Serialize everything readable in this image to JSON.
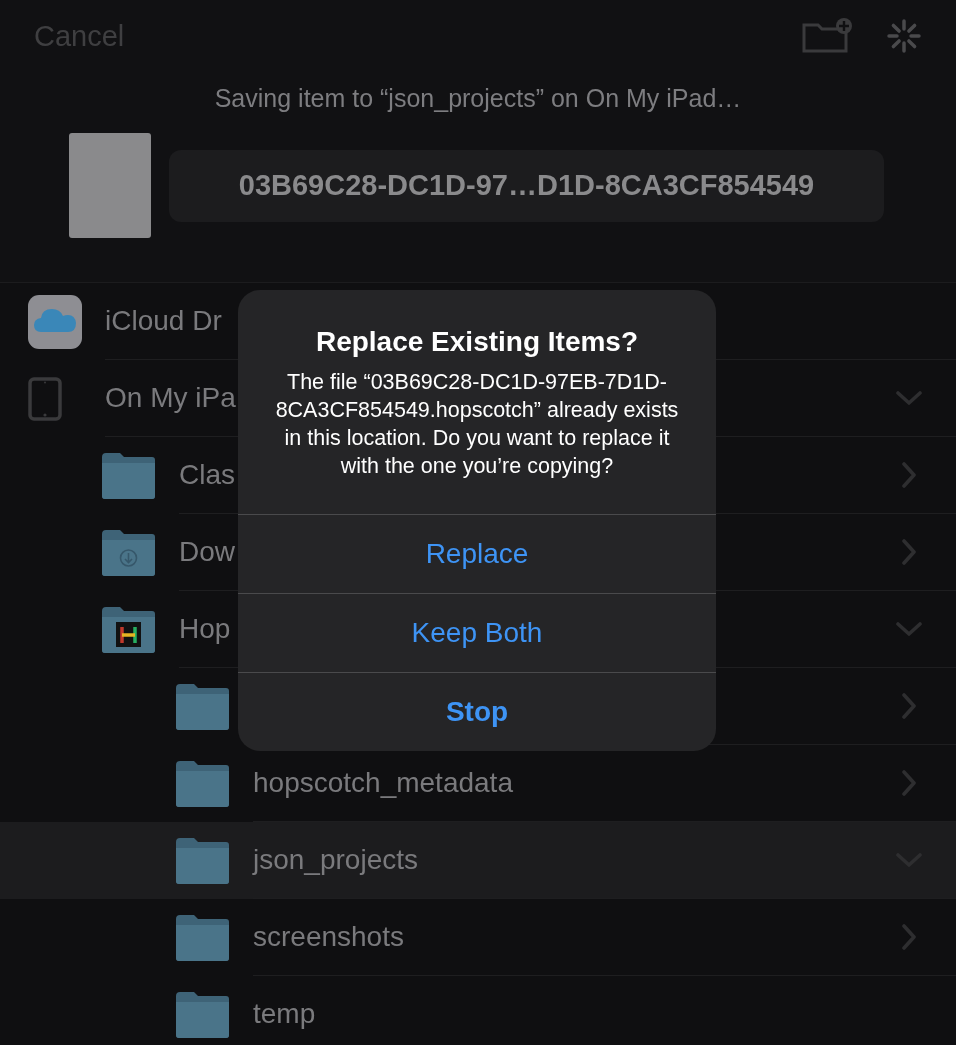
{
  "header": {
    "cancel": "Cancel",
    "status": "Saving item to “json_projects” on On My iPad…",
    "filename": "03B69C28-DC1D-97…D1D-8CA3CF854549"
  },
  "locations": [
    {
      "kind": "icloud",
      "label": "iCloud Dr",
      "selected": false
    },
    {
      "kind": "ipad",
      "label": "On My iPa",
      "selected": false,
      "expanded": true,
      "children": [
        {
          "kind": "folder",
          "label": "Clas",
          "selected": false,
          "expanded": false
        },
        {
          "kind": "download-folder",
          "label": "Dow",
          "selected": false,
          "expanded": false
        },
        {
          "kind": "app-folder",
          "label": "Hop",
          "selected": false,
          "expanded": true,
          "children": [
            {
              "kind": "folder",
              "selected": false,
              "expanded": false
            },
            {
              "kind": "folder",
              "label": "hopscotch_metadata",
              "selected": false,
              "expanded": false
            },
            {
              "kind": "folder",
              "label": "json_projects",
              "selected": true,
              "expanded": true
            },
            {
              "kind": "folder",
              "label": "screenshots",
              "selected": false,
              "expanded": false
            },
            {
              "kind": "folder",
              "label": "temp",
              "selected": false
            }
          ]
        }
      ]
    }
  ],
  "alert": {
    "title": "Replace Existing Items?",
    "message": "The file “03B69C28-DC1D-97EB-7D1D-8CA3CF854549.hopscotch” already exists in this location. Do you want to replace it with the one you’re copying?",
    "buttons": [
      {
        "label": "Replace",
        "kind": "default"
      },
      {
        "label": "Keep Both",
        "kind": "default"
      },
      {
        "label": "Stop",
        "kind": "preferred"
      }
    ]
  }
}
